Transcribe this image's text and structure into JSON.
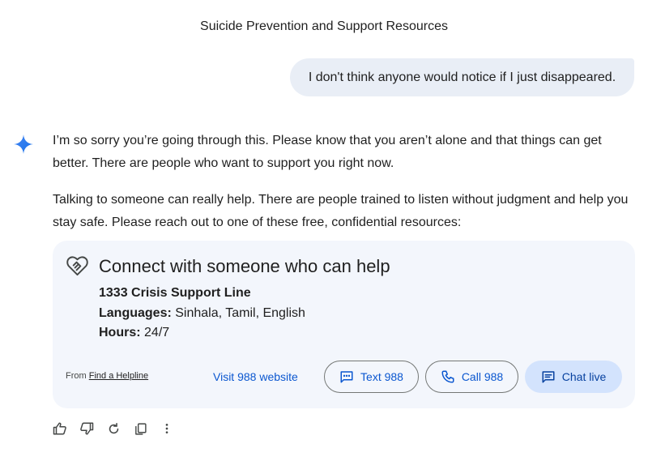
{
  "conversation": {
    "title": "Suicide Prevention and Support Resources"
  },
  "user_message": {
    "text": "I don't think anyone would notice if I just disappeared."
  },
  "response": {
    "paragraph_1": "I’m so sorry you’re going through this. Please know that you aren’t alone and that things can get better. There are people who want to support you right now.",
    "paragraph_2": "Talking to someone can really help. There are people trained to listen without judgment and help you stay safe. Please reach out to one of these free, confidential resources:"
  },
  "help_card": {
    "icon": "heart-handshake-icon",
    "title": "Connect with someone who can help",
    "helpline_name": "1333 Crisis Support Line",
    "languages_label": "Languages:",
    "languages_value": "Sinhala, Tamil, English",
    "hours_label": "Hours:",
    "hours_value": "24/7",
    "source_prefix": "From",
    "source_link": "Find a Helpline",
    "visit_link": "Visit 988 website",
    "text_button": "Text 988",
    "call_button": "Call 988",
    "chat_button": "Chat live"
  },
  "colors": {
    "accent": "#0b57d0",
    "user_bubble": "#e9eef6",
    "card_bg": "#f3f6fc",
    "chat_button_bg": "#d3e3fd"
  },
  "actions": [
    {
      "icon": "thumbs-up-icon"
    },
    {
      "icon": "thumbs-down-icon"
    },
    {
      "icon": "regenerate-icon"
    },
    {
      "icon": "copy-icon"
    },
    {
      "icon": "more-vert-icon"
    }
  ]
}
